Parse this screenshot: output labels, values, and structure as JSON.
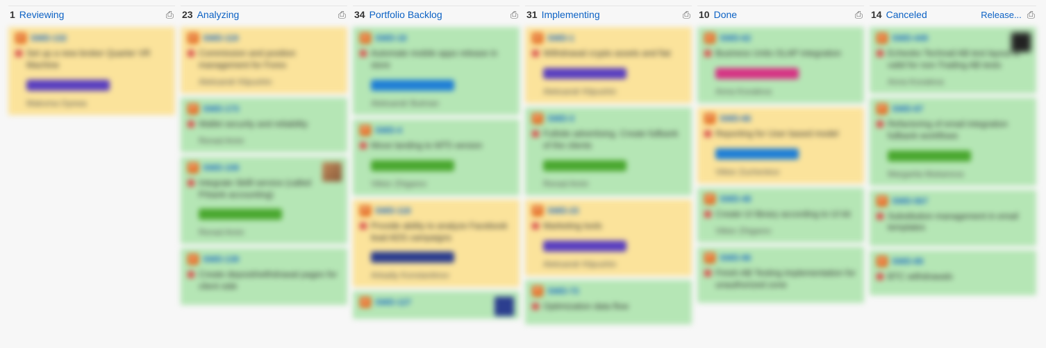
{
  "release_link": "Release...",
  "columns": [
    {
      "count": "1",
      "title": "Reviewing",
      "cards": [
        {
          "color": "yellow",
          "id": "SWD-132",
          "title": "Set up a new broker Quarter VR Machine",
          "tag": "purple",
          "assignee": "Makoma Oyewa"
        }
      ]
    },
    {
      "count": "23",
      "title": "Analyzing",
      "cards": [
        {
          "color": "yellow",
          "id": "SWD-119",
          "title": "Commission and position management for Forex",
          "assignee": "Aleksandr Klipushin"
        },
        {
          "color": "green",
          "id": "SWD-173",
          "title": "Wallet security and reliability",
          "assignee": "Renad Amin"
        },
        {
          "color": "green",
          "id": "SWD-108",
          "title": "Integrate Skilll service (called Prbank accounting)",
          "tag": "green",
          "assignee": "Renad Amin",
          "avatar": true
        },
        {
          "color": "green",
          "id": "SWD-139",
          "title": "Create deposit/withdrawal pages for client side"
        }
      ]
    },
    {
      "count": "34",
      "title": "Portfolio Backlog",
      "cards": [
        {
          "color": "green",
          "id": "SWD-18",
          "title": "Automate mobile apps release in store",
          "tag": "blue",
          "assignee": "Aleksandr Butman"
        },
        {
          "color": "green",
          "id": "SWD-4",
          "title": "Move landing to MT5 version",
          "tag": "green",
          "assignee": "Viktor Zhigarev"
        },
        {
          "color": "yellow",
          "id": "SWD-118",
          "title": "Provide ability to analyze Facebook lead ADS campaigns",
          "tag": "navy",
          "assignee": "Arkadiy Konstantinov"
        },
        {
          "color": "green",
          "id": "SWD-127",
          "title": "",
          "avatar": "navy"
        }
      ]
    },
    {
      "count": "31",
      "title": "Implementing",
      "cards": [
        {
          "color": "yellow",
          "id": "SWD-1",
          "title": "Withdrawal crypto assets and fiat",
          "tag": "purple",
          "assignee": "Aleksandr Klipushin"
        },
        {
          "color": "green",
          "id": "SWD-3",
          "title": "Fullsite advertising. Create fullbank of the clients",
          "tag": "green",
          "assignee": "Renad Amin"
        },
        {
          "color": "yellow",
          "id": "SWD-23",
          "title": "Marketing tools",
          "tag": "purple",
          "assignee": "Aleksandr Klipushin"
        },
        {
          "color": "green",
          "id": "SWD-73",
          "title": "Optimization data flow"
        }
      ]
    },
    {
      "count": "10",
      "title": "Done",
      "cards": [
        {
          "color": "green",
          "id": "SWD-62",
          "title": "Business Units OLAP integration",
          "tag": "magenta",
          "assignee": "Anna Kovaleva"
        },
        {
          "color": "yellow",
          "id": "SWD-66",
          "title": "Reporting for User based model",
          "tag": "blue",
          "assignee": "Viktor Zuchenkov"
        },
        {
          "color": "green",
          "id": "SWD-48",
          "title": "Create UI library according to UI kit",
          "assignee": "Viktor Zhigarev"
        },
        {
          "color": "green",
          "id": "SWD-96",
          "title": "Finish AB Testing implementation for unauthorized zone"
        }
      ]
    },
    {
      "count": "14",
      "title": "Canceled",
      "release": true,
      "cards": [
        {
          "color": "green",
          "id": "SWD-449",
          "title": "Echeoko Technail AB test layout is valid for non-Trading AB tests",
          "assignee": "Anna Kovaleva",
          "avatar": "dark"
        },
        {
          "color": "green",
          "id": "SWD-87",
          "title": "Refactoring of email integration fullbank workflows",
          "tag": "green",
          "assignee": "Margarita Mukanova"
        },
        {
          "color": "green",
          "id": "SWD-567",
          "title": "Substitution management in email templates"
        },
        {
          "color": "green",
          "id": "SWD-89",
          "title": "BTC withdrawals"
        }
      ]
    }
  ]
}
